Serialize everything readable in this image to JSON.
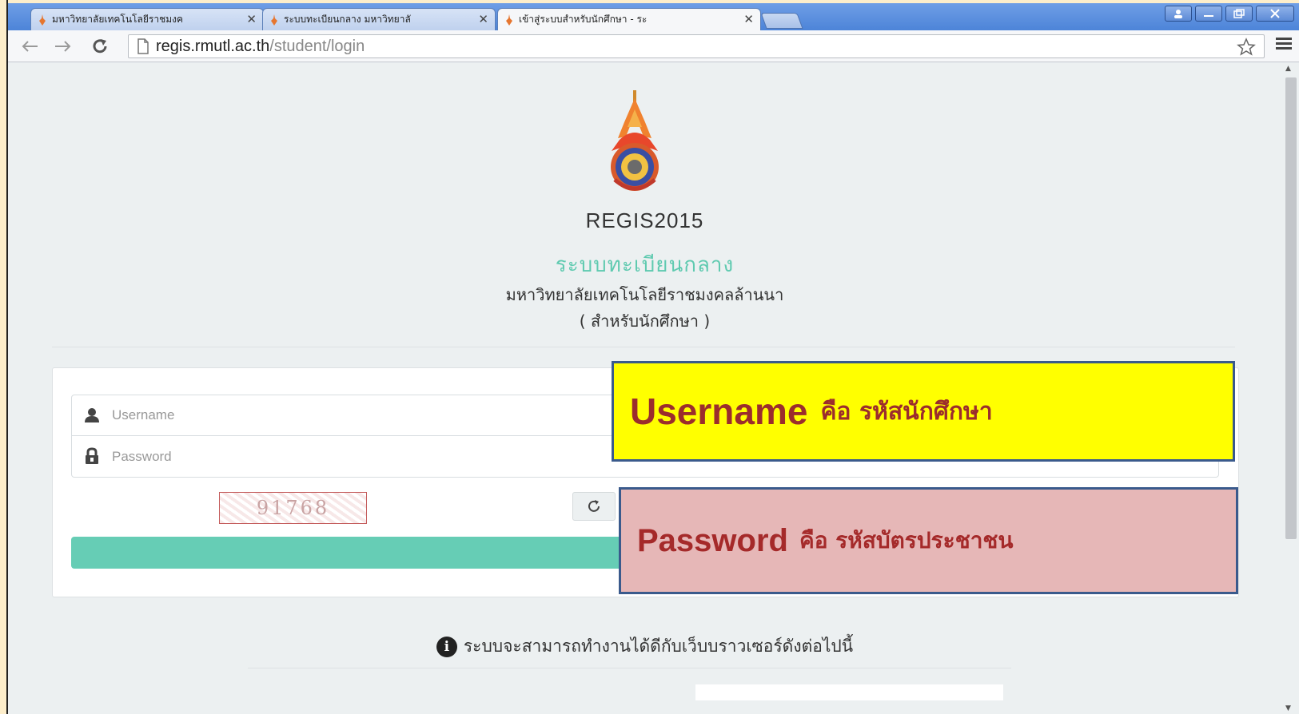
{
  "browser": {
    "tabs": [
      {
        "title": "มหาวิทยาลัยเทคโนโลยีราชมงค",
        "active": false
      },
      {
        "title": "ระบบทะเบียนกลาง มหาวิทยาลั",
        "active": false
      },
      {
        "title": "เข้าสู่ระบบสำหรับนักศึกษา - ระ",
        "active": true
      }
    ],
    "close_glyph": "✕",
    "url_host": "regis.rmutl.ac.th",
    "url_path": "/student/login",
    "icons": [
      "back-arrow-icon",
      "forward-arrow-icon",
      "reload-icon",
      "page-icon",
      "star-icon",
      "menu-icon"
    ]
  },
  "page": {
    "system_name": "REGIS2015",
    "title_thai": "ระบบทะเบียนกลาง",
    "university_thai": "มหาวิทยาลัยเทคโนโลยีราชมงคลล้านนา",
    "audience_thai": "( สำหรับนักศึกษา )",
    "username_placeholder": "Username",
    "password_placeholder": "Password",
    "captcha_text": "91768",
    "login_icon": "⎆",
    "browser_note": "ระบบจะสามารถทำงานได้ดีกับเว็บบราวเซอร์ดังต่อไปนี้",
    "info_glyph": "i"
  },
  "callouts": {
    "username_key": "Username",
    "username_desc": "คือ รหัสนักศึกษา",
    "password_key": "Password",
    "password_desc": "คือ  รหัสบัตรประชาชน"
  },
  "colors": {
    "accent": "#66cdb5",
    "title_thai": "#5fcab0",
    "callout_user_bg": "#ffff00",
    "callout_pass_bg": "#e6b7b7",
    "callout_text": "#9b2d2d"
  }
}
